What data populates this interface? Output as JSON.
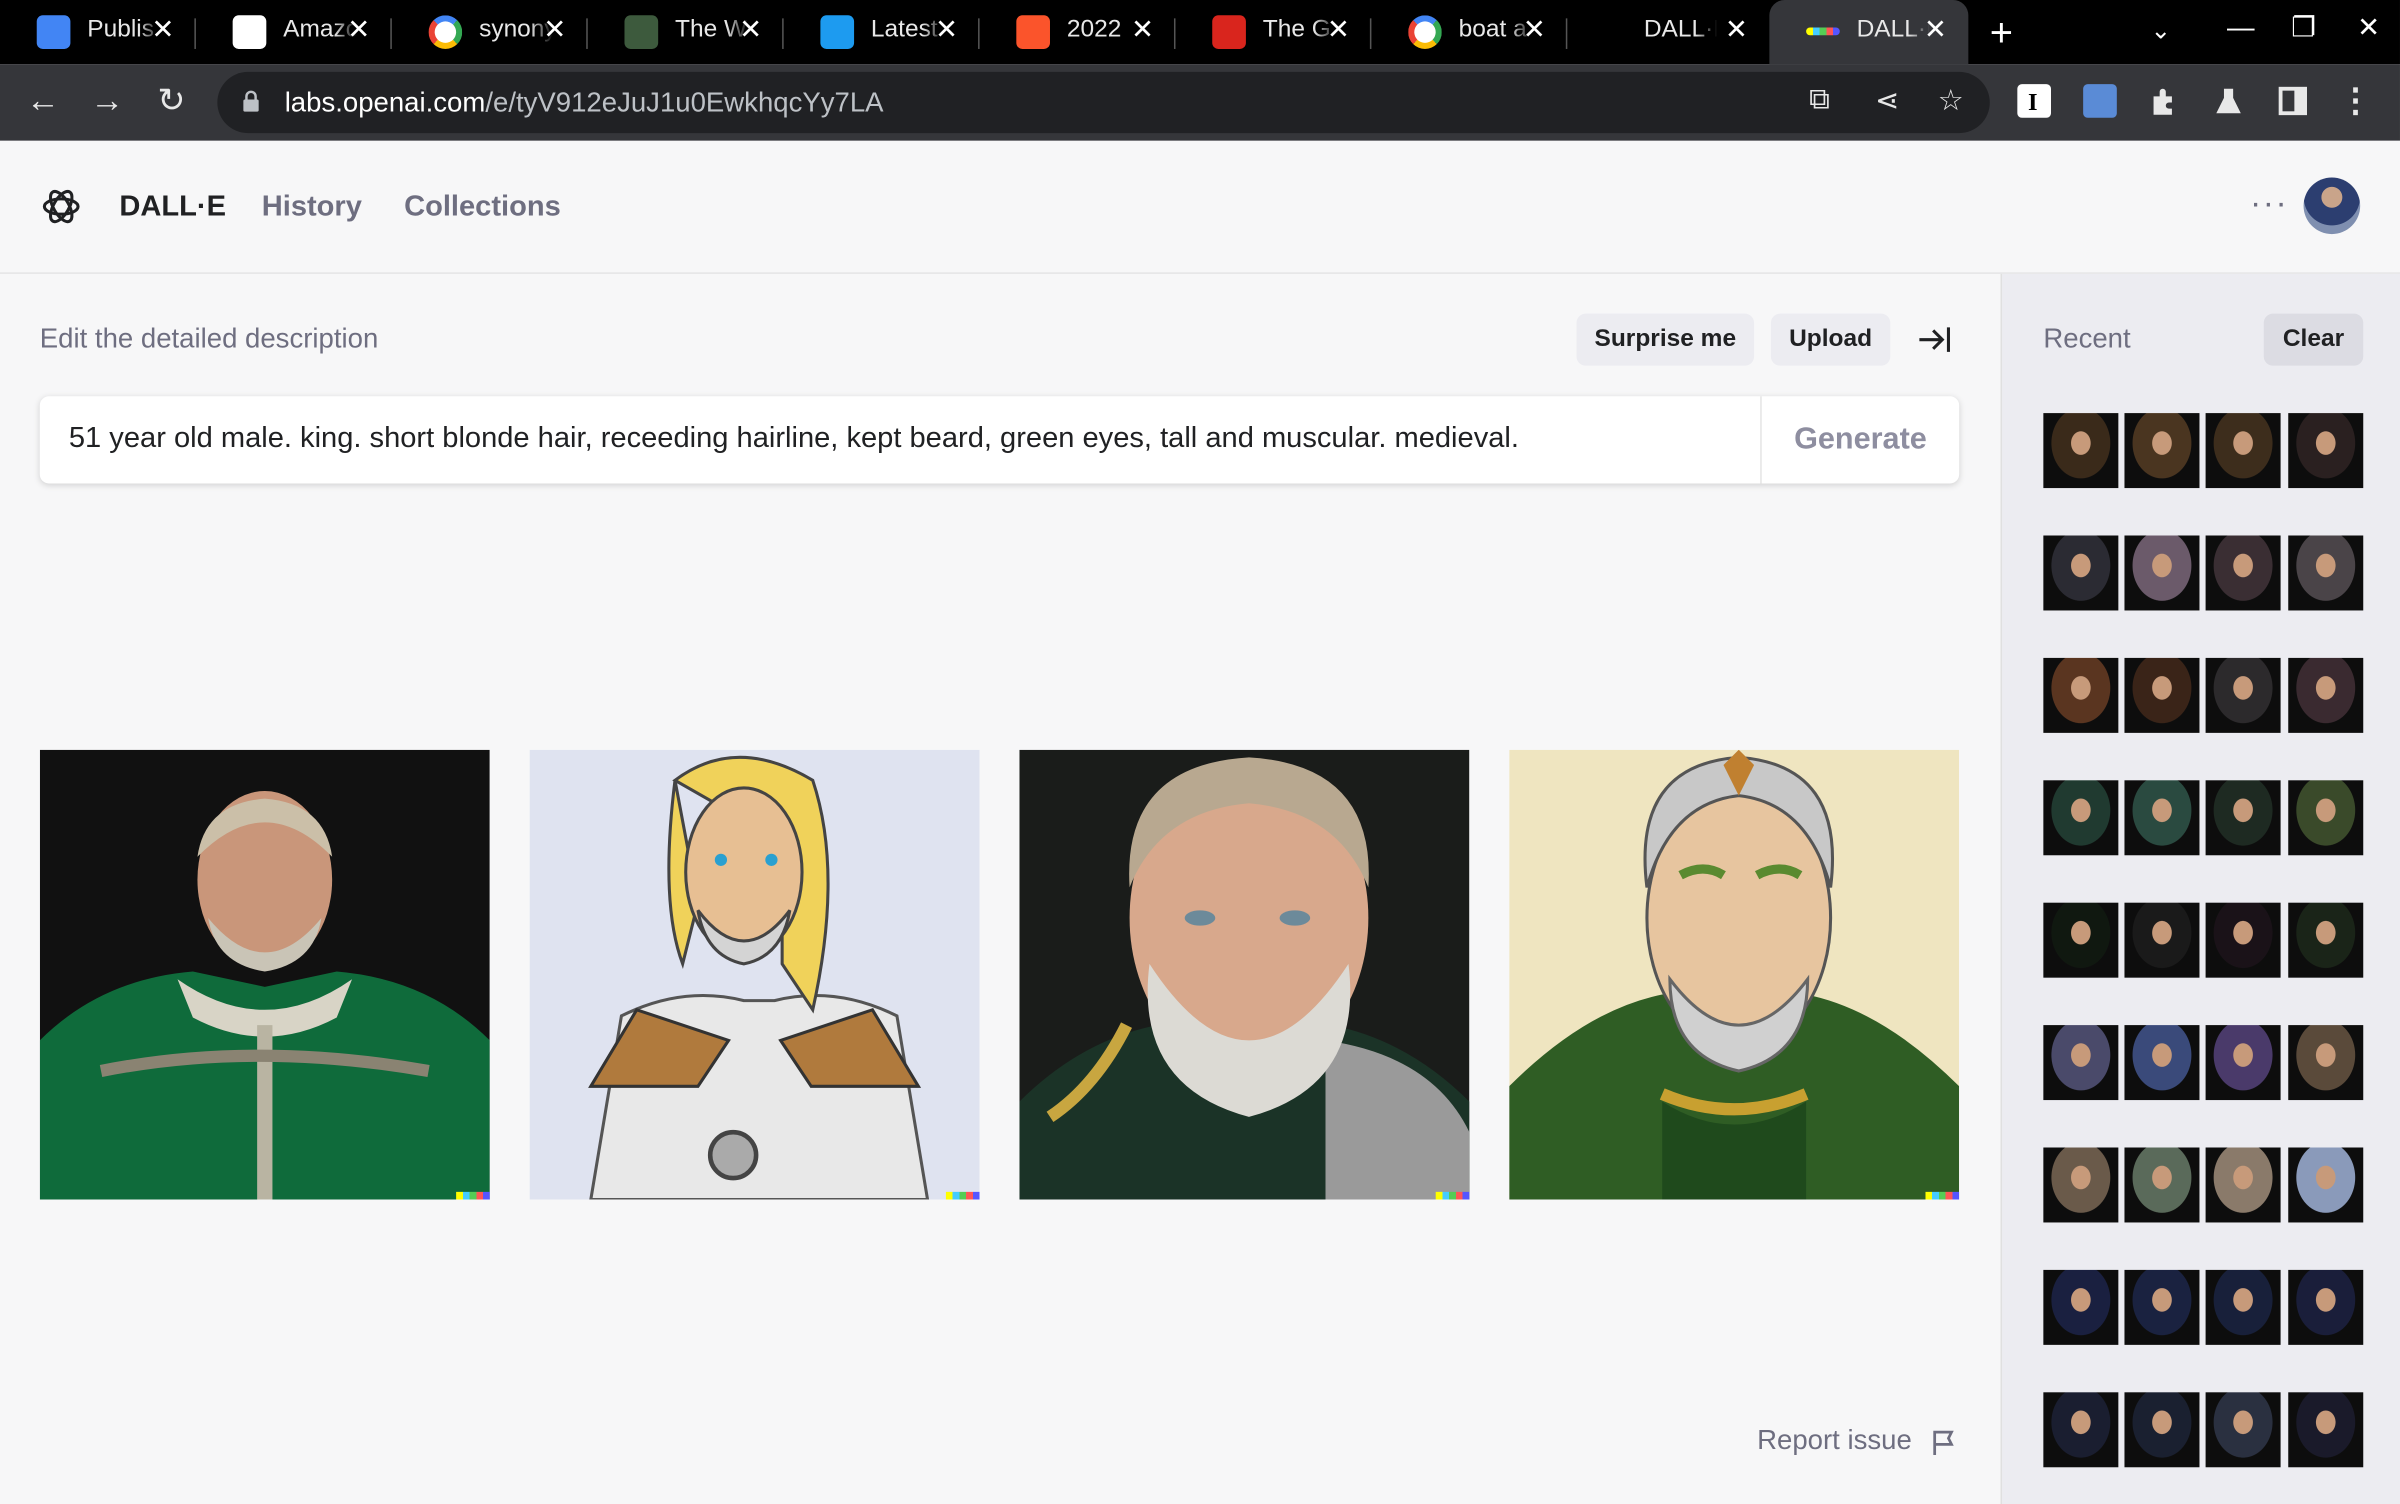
{
  "browser": {
    "tabs": [
      {
        "title": "Publis",
        "favicon": "docs-icon",
        "color": "#4285f4"
      },
      {
        "title": "Amazon",
        "favicon": "amazon-icon",
        "color": "#ffffff"
      },
      {
        "title": "synonym",
        "favicon": "google-icon",
        "color": "#ffffff"
      },
      {
        "title": "The W",
        "favicon": "game-icon",
        "color": "#3d5a3d"
      },
      {
        "title": "Latest",
        "favicon": "twitter-icon",
        "color": "#1d9bf0"
      },
      {
        "title": "2022",
        "favicon": "brave-icon",
        "color": "#fb542b"
      },
      {
        "title": "The G",
        "favicon": "b-icon",
        "color": "#d9251d"
      },
      {
        "title": "boat a",
        "favicon": "google-icon",
        "color": "#ffffff"
      },
      {
        "title": "DALL·E",
        "favicon": "none",
        "color": "#000000"
      },
      {
        "title": "DALL·E",
        "favicon": "dalle-icon",
        "color": "#35363a",
        "active": true
      }
    ],
    "url_host": "labs.openai.com",
    "url_path": "/e/tyV912eJuJ1u0EwkhqcYy7LA"
  },
  "header": {
    "brand": "DALL·E",
    "nav": [
      "History",
      "Collections"
    ],
    "more_label": "···"
  },
  "editor": {
    "label": "Edit the detailed description",
    "surprise_label": "Surprise me",
    "upload_label": "Upload",
    "prompt": "51 year old male. king. short blonde hair, receeding hairline, kept beard, green eyes, tall and muscular. medieval.",
    "generate_label": "Generate"
  },
  "results": [
    {
      "name": "result-image-1",
      "style": "photo"
    },
    {
      "name": "result-image-2",
      "style": "cartoon"
    },
    {
      "name": "result-image-3",
      "style": "photo"
    },
    {
      "name": "result-image-4",
      "style": "painting"
    }
  ],
  "report_label": "Report issue",
  "sidebar": {
    "title": "Recent",
    "clear_label": "Clear",
    "rows": [
      [
        "#3a2a1a",
        "#4a3520",
        "#3d2d1c",
        "#2a2020"
      ],
      [
        "#2b2b33",
        "#6b5a6a",
        "#3a2e33",
        "#4a4448"
      ],
      [
        "#5a3520",
        "#3a2418",
        "#2c2a2c",
        "#3a2a30"
      ],
      [
        "#203a30",
        "#2a4a40",
        "#1e2a22",
        "#3a4a2a"
      ],
      [
        "#101810",
        "#1a1a1a",
        "#1a1218",
        "#1a2418"
      ],
      [
        "#4a4a6a",
        "#3a4a7a",
        "#4a3a6a",
        "#5a4a3a"
      ],
      [
        "#6a5a4a",
        "#5a6a5a",
        "#8a7a6a",
        "#8a9aba"
      ],
      [
        "#1a2040",
        "#1a2240",
        "#18203a",
        "#1a1e3a"
      ],
      [
        "#1a1e30",
        "#1a2030",
        "#2a3040",
        "#1a1a2a"
      ]
    ]
  }
}
